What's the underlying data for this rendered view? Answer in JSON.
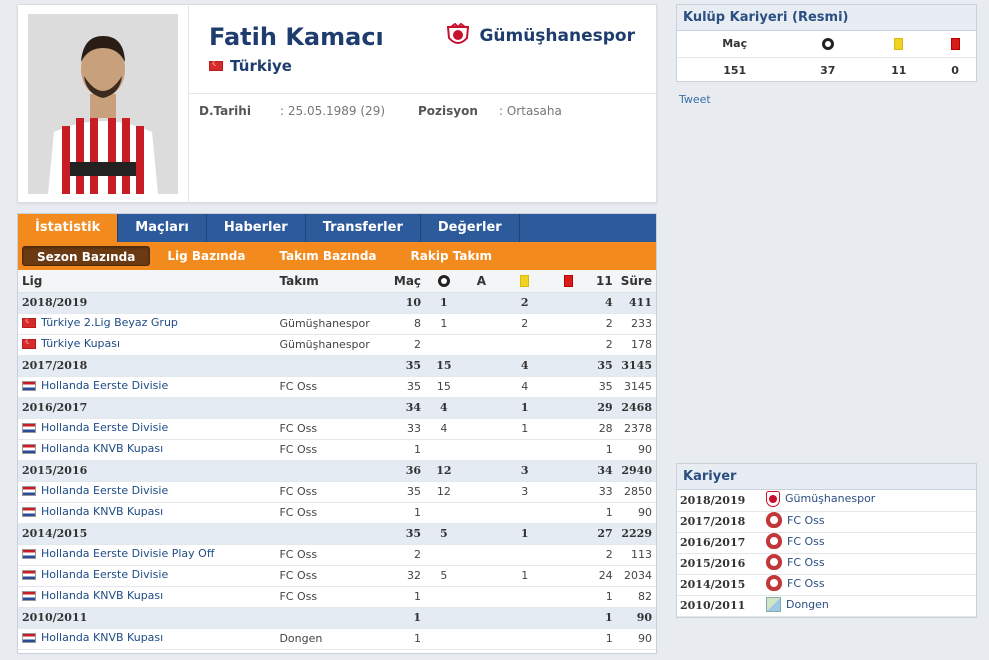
{
  "player": {
    "name": "Fatih Kamacı",
    "country": "Türkiye",
    "club": "Gümüşhanespor",
    "birth_label": "D.Tarihi",
    "birth_value": ": 25.05.1989 (29)",
    "position_label": "Pozisyon",
    "position_value": ": Ortasaha"
  },
  "tabs": [
    "İstatistik",
    "Maçları",
    "Haberler",
    "Transferler",
    "Değerler"
  ],
  "subtabs": [
    "Sezon Bazında",
    "Lig Bazında",
    "Takım Bazında",
    "Rakip Takım"
  ],
  "stats": {
    "headers": {
      "lig": "Lig",
      "takim": "Takım",
      "mac": "Maç",
      "a": "A",
      "eleven": "11",
      "sure": "Süre"
    },
    "rows": [
      {
        "type": "season",
        "lig": "2018/2019",
        "mac": "10",
        "gol": "1",
        "a": "",
        "yellow": "2",
        "red": "",
        "eleven": "4",
        "sure": "411"
      },
      {
        "type": "row",
        "flag": "tr",
        "lig": "Türkiye 2.Lig Beyaz Grup",
        "takim": "Gümüşhanespor",
        "mac": "8",
        "gol": "1",
        "a": "",
        "yellow": "2",
        "red": "",
        "eleven": "2",
        "sure": "233"
      },
      {
        "type": "row",
        "flag": "tr",
        "lig": "Türkiye Kupası",
        "takim": "Gümüşhanespor",
        "mac": "2",
        "gol": "",
        "a": "",
        "yellow": "",
        "red": "",
        "eleven": "2",
        "sure": "178"
      },
      {
        "type": "season",
        "lig": "2017/2018",
        "mac": "35",
        "gol": "15",
        "a": "",
        "yellow": "4",
        "red": "",
        "eleven": "35",
        "sure": "3145"
      },
      {
        "type": "row",
        "flag": "nl",
        "lig": "Hollanda Eerste Divisie",
        "takim": "FC Oss",
        "mac": "35",
        "gol": "15",
        "a": "",
        "yellow": "4",
        "red": "",
        "eleven": "35",
        "sure": "3145"
      },
      {
        "type": "season",
        "lig": "2016/2017",
        "mac": "34",
        "gol": "4",
        "a": "",
        "yellow": "1",
        "red": "",
        "eleven": "29",
        "sure": "2468"
      },
      {
        "type": "row",
        "flag": "nl",
        "lig": "Hollanda Eerste Divisie",
        "takim": "FC Oss",
        "mac": "33",
        "gol": "4",
        "a": "",
        "yellow": "1",
        "red": "",
        "eleven": "28",
        "sure": "2378"
      },
      {
        "type": "row",
        "flag": "nl",
        "lig": "Hollanda KNVB Kupası",
        "takim": "FC Oss",
        "mac": "1",
        "gol": "",
        "a": "",
        "yellow": "",
        "red": "",
        "eleven": "1",
        "sure": "90"
      },
      {
        "type": "season",
        "lig": "2015/2016",
        "mac": "36",
        "gol": "12",
        "a": "",
        "yellow": "3",
        "red": "",
        "eleven": "34",
        "sure": "2940"
      },
      {
        "type": "row",
        "flag": "nl",
        "lig": "Hollanda Eerste Divisie",
        "takim": "FC Oss",
        "mac": "35",
        "gol": "12",
        "a": "",
        "yellow": "3",
        "red": "",
        "eleven": "33",
        "sure": "2850"
      },
      {
        "type": "row",
        "flag": "nl",
        "lig": "Hollanda KNVB Kupası",
        "takim": "FC Oss",
        "mac": "1",
        "gol": "",
        "a": "",
        "yellow": "",
        "red": "",
        "eleven": "1",
        "sure": "90"
      },
      {
        "type": "season",
        "lig": "2014/2015",
        "mac": "35",
        "gol": "5",
        "a": "",
        "yellow": "1",
        "red": "",
        "eleven": "27",
        "sure": "2229"
      },
      {
        "type": "row",
        "flag": "nl",
        "lig": "Hollanda Eerste Divisie Play Off",
        "takim": "FC Oss",
        "mac": "2",
        "gol": "",
        "a": "",
        "yellow": "",
        "red": "",
        "eleven": "2",
        "sure": "113"
      },
      {
        "type": "row",
        "flag": "nl",
        "lig": "Hollanda Eerste Divisie",
        "takim": "FC Oss",
        "mac": "32",
        "gol": "5",
        "a": "",
        "yellow": "1",
        "red": "",
        "eleven": "24",
        "sure": "2034"
      },
      {
        "type": "row",
        "flag": "nl",
        "lig": "Hollanda KNVB Kupası",
        "takim": "FC Oss",
        "mac": "1",
        "gol": "",
        "a": "",
        "yellow": "",
        "red": "",
        "eleven": "1",
        "sure": "82"
      },
      {
        "type": "season",
        "lig": "2010/2011",
        "mac": "1",
        "gol": "",
        "a": "",
        "yellow": "",
        "red": "",
        "eleven": "1",
        "sure": "90"
      },
      {
        "type": "row",
        "flag": "nl",
        "lig": "Hollanda KNVB Kupası",
        "takim": "Dongen",
        "mac": "1",
        "gol": "",
        "a": "",
        "yellow": "",
        "red": "",
        "eleven": "1",
        "sure": "90"
      }
    ]
  },
  "club_career": {
    "title": "Kulüp Kariyeri (Resmi)",
    "mac_label": "Maç",
    "mac": "151",
    "gol": "37",
    "yellow": "11",
    "red": "0"
  },
  "tweet": "Tweet",
  "career": {
    "title": "Kariyer",
    "rows": [
      {
        "season": "2018/2019",
        "club": "Gümüşhanespor",
        "crest": "gumushane"
      },
      {
        "season": "2017/2018",
        "club": "FC Oss",
        "crest": "oss"
      },
      {
        "season": "2016/2017",
        "club": "FC Oss",
        "crest": "oss"
      },
      {
        "season": "2015/2016",
        "club": "FC Oss",
        "crest": "oss"
      },
      {
        "season": "2014/2015",
        "club": "FC Oss",
        "crest": "oss"
      },
      {
        "season": "2010/2011",
        "club": "Dongen",
        "crest": "broken-image"
      }
    ]
  },
  "colors": {
    "nav_blue": "#2d5a9b",
    "accent_orange": "#f28a1e",
    "title_blue": "#1e3d6e"
  }
}
